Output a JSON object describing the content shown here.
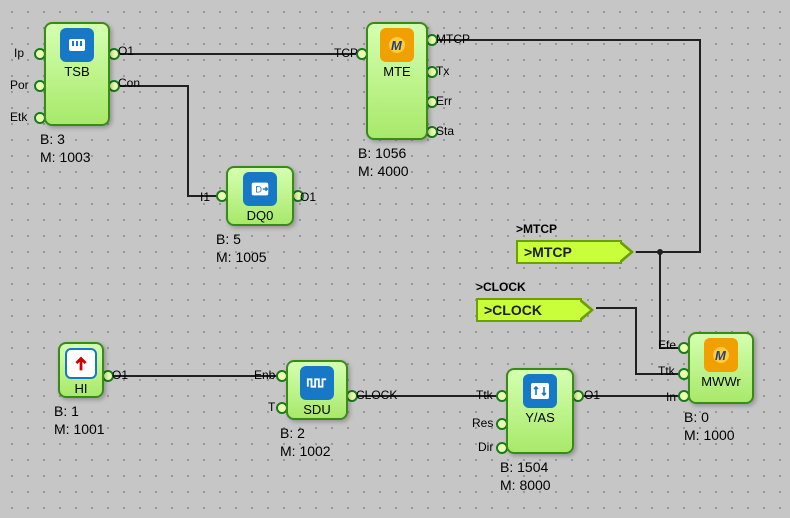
{
  "blocks": {
    "tsb": {
      "title": "TSB",
      "b_line": "B: 3",
      "m_line": "M: 1003"
    },
    "dq0": {
      "title": "DQ0",
      "b_line": "B: 5",
      "m_line": "M: 1005"
    },
    "mte": {
      "title": "MTE",
      "b_line": "B: 1056",
      "m_line": "M: 4000"
    },
    "hi": {
      "title": "HI",
      "b_line": "B: 1",
      "m_line": "M: 1001"
    },
    "sdu": {
      "title": "SDU",
      "b_line": "B: 2",
      "m_line": "M: 1002"
    },
    "yas": {
      "title": "Y/AS",
      "b_line": "B: 1504",
      "m_line": "M: 8000"
    },
    "mwwr": {
      "title": "MWWr",
      "b_line": "B: 0",
      "m_line": "M: 1000"
    }
  },
  "pins": {
    "tsb": {
      "ip": "Ip",
      "por": "Por",
      "etk": "Etk",
      "o1": "O1",
      "con": "Con"
    },
    "dq0": {
      "i1": "I1",
      "o1": "O1"
    },
    "mte": {
      "tcp": "TCP",
      "mtcp": "MTCP",
      "tx": "Tx",
      "err": "Err",
      "sta": "Sta"
    },
    "hi": {
      "o1": "O1"
    },
    "sdu": {
      "enb": "Enb",
      "t": "T",
      "clock": "CLOCK"
    },
    "yas": {
      "ttk": "Ttk",
      "res": "Res",
      "dir": "Dir",
      "o1": "O1"
    },
    "mwwr": {
      "efe": "Efe",
      "ttk": "Ttk",
      "in": "In"
    }
  },
  "nets": {
    "mtcp": ">MTCP",
    "clock": ">CLOCK"
  }
}
